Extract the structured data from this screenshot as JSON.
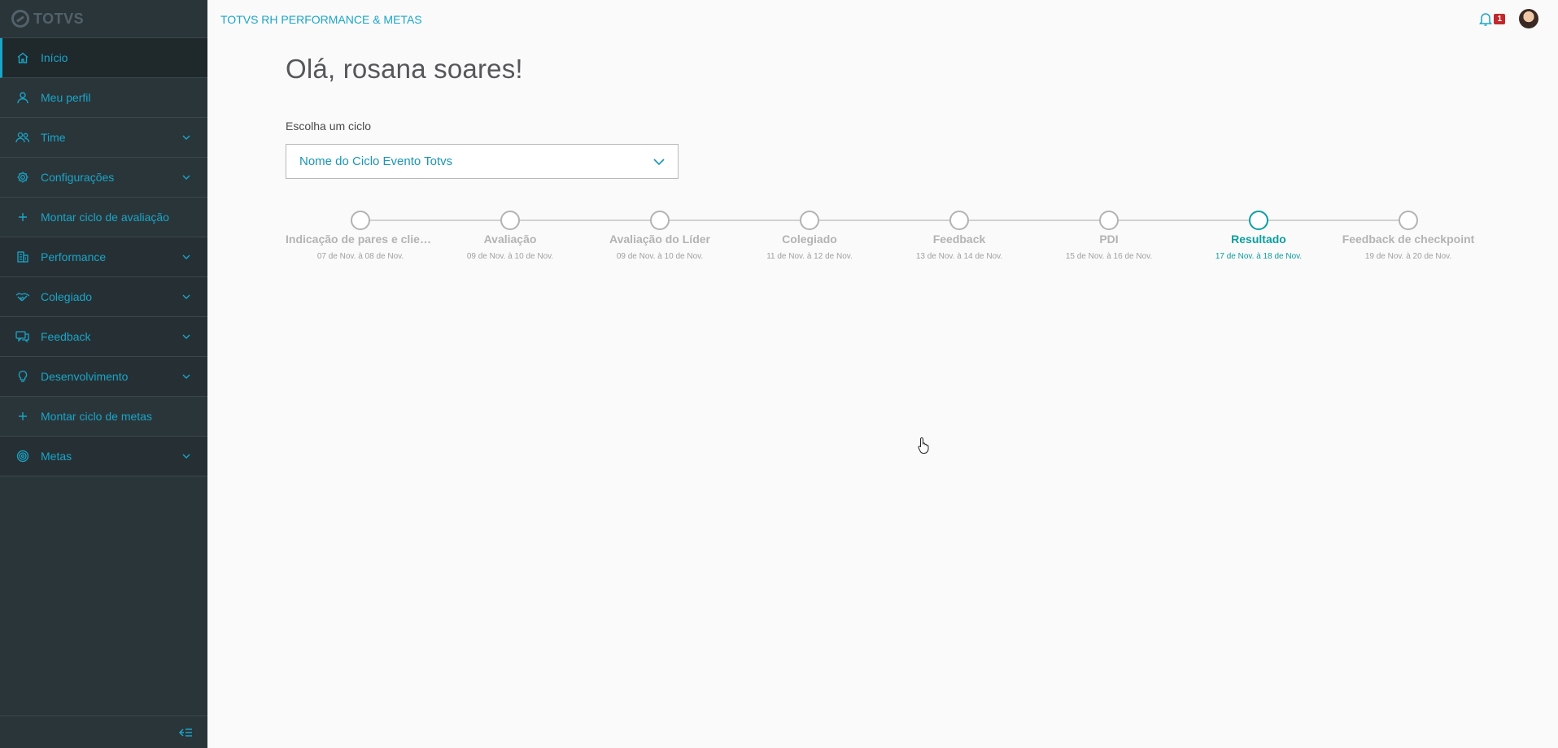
{
  "sidebar": {
    "logo_text": "TOTVS",
    "items": [
      {
        "label": "Início",
        "icon": "home-icon"
      },
      {
        "label": "Meu perfil",
        "icon": "user-icon"
      },
      {
        "label": "Time",
        "icon": "team-icon"
      },
      {
        "label": "Configurações",
        "icon": "gear-icon"
      },
      {
        "label": "Montar ciclo de avaliação",
        "icon": "plus-icon"
      },
      {
        "label": "Performance",
        "icon": "building-icon"
      },
      {
        "label": "Colegiado",
        "icon": "handshake-icon"
      },
      {
        "label": "Feedback",
        "icon": "chat-icon"
      },
      {
        "label": "Desenvolvimento",
        "icon": "lightbulb-icon"
      },
      {
        "label": "Montar ciclo de metas",
        "icon": "plus-icon"
      },
      {
        "label": "Metas",
        "icon": "target-icon"
      }
    ]
  },
  "header": {
    "title": "TOTVS RH PERFORMANCE & METAS",
    "notification_count": "1"
  },
  "main": {
    "greeting": "Olá, rosana soares!",
    "cycle_label": "Escolha um ciclo",
    "cycle_selected": "Nome do Ciclo Evento Totvs"
  },
  "steps": [
    {
      "label": "Indicação de pares e clientes",
      "date": "07 de Nov. à 08 de Nov."
    },
    {
      "label": "Avaliação",
      "date": "09 de Nov. à 10 de Nov."
    },
    {
      "label": "Avaliação do Líder",
      "date": "09 de Nov. à 10 de Nov."
    },
    {
      "label": "Colegiado",
      "date": "11 de Nov. à 12 de Nov."
    },
    {
      "label": "Feedback",
      "date": "13 de Nov. à 14 de Nov."
    },
    {
      "label": "PDI",
      "date": "15 de Nov. à 16 de Nov."
    },
    {
      "label": "Resultado",
      "date": "17 de Nov. à 18 de Nov."
    },
    {
      "label": "Feedback de checkpoint",
      "date": "19 de Nov. à 20 de Nov."
    }
  ],
  "current_step": "Resultado",
  "colors": {
    "sidebar_bg": "#2a3539",
    "accent": "#1aa5c8",
    "current_step": "#0c9ea0",
    "badge": "#c0282d"
  }
}
